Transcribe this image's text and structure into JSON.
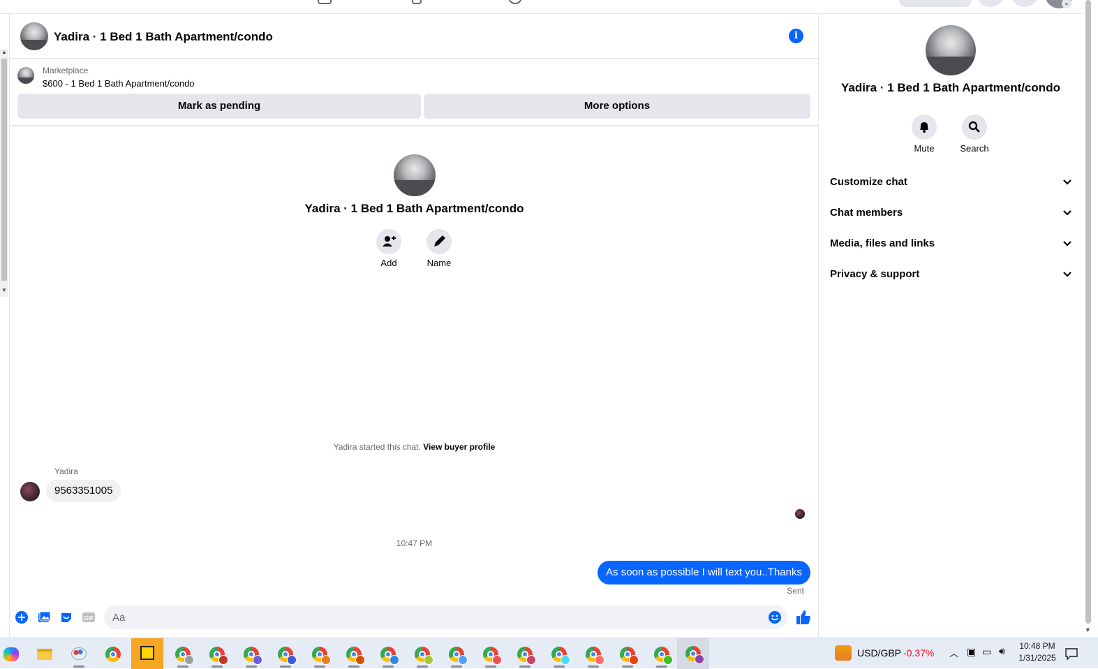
{
  "header": {
    "title": "Yadira · 1 Bed 1 Bath Apartment/condo"
  },
  "marketplace": {
    "label": "Marketplace",
    "listing": "$600 - 1 Bed 1 Bath Apartment/condo",
    "mark_pending": "Mark as pending",
    "more_options": "More options"
  },
  "conversation": {
    "name": "Yadira · 1 Bed 1 Bath Apartment/condo",
    "add_label": "Add",
    "name_label": "Name",
    "started_text": "Yadira started this chat.",
    "view_buyer_profile": "View buyer profile",
    "messages": [
      {
        "sender": "Yadira",
        "text": "9563351005",
        "direction": "incoming"
      },
      {
        "text": "As soon as possible I will text you..Thanks",
        "direction": "outgoing",
        "status": "Sent"
      }
    ],
    "timestamp": "10:47 PM"
  },
  "composer": {
    "placeholder": "Aa"
  },
  "sidebar": {
    "name": "Yadira · 1 Bed 1 Bath Apartment/condo",
    "mute_label": "Mute",
    "search_label": "Search",
    "sections": [
      {
        "label": "Customize chat"
      },
      {
        "label": "Chat members"
      },
      {
        "label": "Media, files and links"
      },
      {
        "label": "Privacy & support"
      }
    ]
  },
  "taskbar": {
    "ticker_symbol": "USD/GBP",
    "ticker_change": "-0.37%",
    "time": "10:48 PM",
    "date": "1/31/2025"
  },
  "colors": {
    "accent": "#0866ff",
    "bubble_in": "#f0f0f0",
    "button_bg": "#e4e6eb",
    "ticker_negative": "#e81123"
  }
}
